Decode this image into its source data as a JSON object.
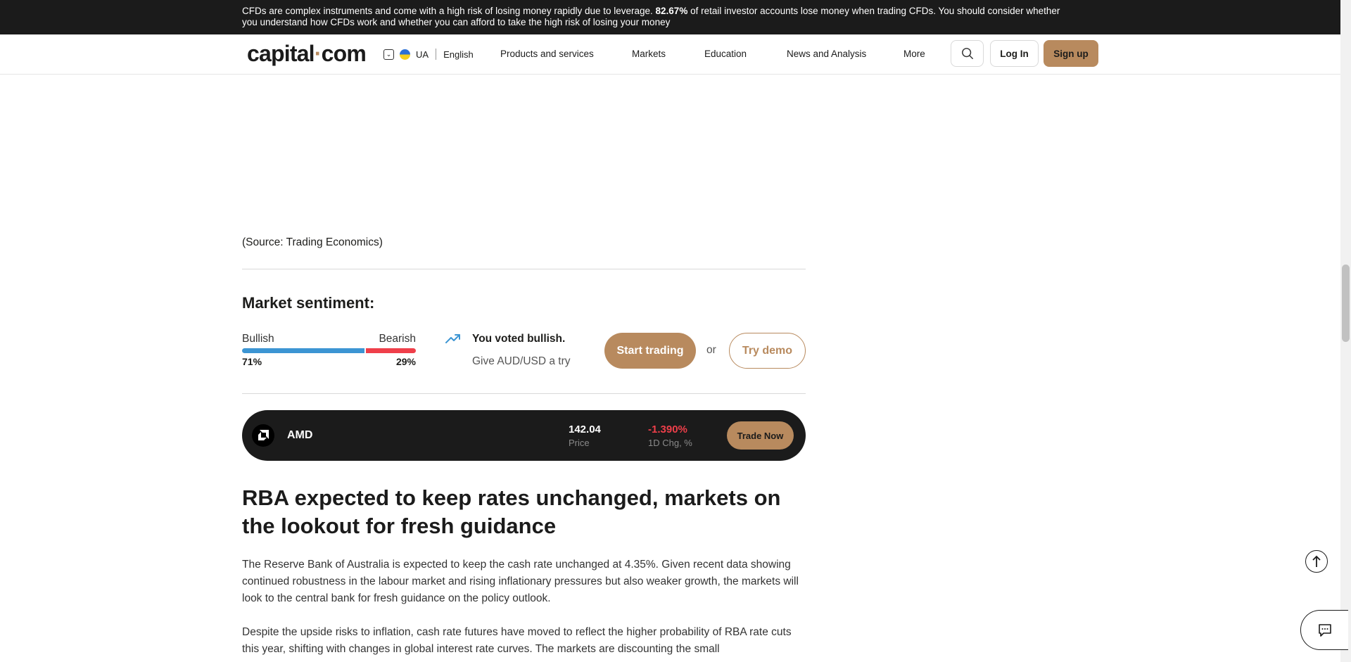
{
  "risk_banner": {
    "text_before": "CFDs are complex instruments and come with a high risk of losing money rapidly due to leverage. ",
    "percent": "82.67%",
    "text_after": " of retail investor accounts lose money when trading CFDs. You should consider whether you understand how CFDs work and whether you can afford to take the high risk of losing your money"
  },
  "header": {
    "logo_left": "capital",
    "logo_dot": "·",
    "logo_right": "com",
    "region_code": "UA",
    "language": "English",
    "nav": [
      "Products and services",
      "Markets",
      "Education",
      "News and Analysis",
      "More"
    ],
    "login_label": "Log In",
    "signup_label": "Sign up"
  },
  "article": {
    "source": "(Source: Trading Economics)",
    "headline": "RBA expected to keep rates unchanged, markets on the lookout for fresh guidance",
    "paragraphs": [
      "The Reserve Bank of Australia is expected to keep the cash rate unchanged at 4.35%. Given recent data showing continued robustness in the labour market and rising inflationary pressures but also weaker growth, the markets will look to the central bank for fresh guidance on the policy outlook.",
      "Despite the upside risks to inflation, cash rate futures have moved to reflect the higher probability of RBA rate cuts this year, shifting with changes in global interest rate curves. The markets are discounting the small"
    ]
  },
  "sentiment": {
    "title": "Market sentiment:",
    "bullish_label": "Bullish",
    "bearish_label": "Bearish",
    "bullish_pct": "71%",
    "bearish_pct": "29%",
    "bullish_fraction": 0.71,
    "voted_text": "You voted bullish.",
    "give_text": "Give AUD/USD a try",
    "start_label": "Start trading",
    "or_label": "or",
    "demo_label": "Try demo"
  },
  "ticker": {
    "name": "AMD",
    "price": "142.04",
    "price_label": "Price",
    "change": "-1.390%",
    "change_label": "1D Chg, %",
    "trade_label": "Trade Now"
  },
  "colors": {
    "accent": "#b88a5e",
    "bullish": "#3c95d3",
    "bearish": "#ef3f4a",
    "dark": "#1b1b1b"
  },
  "icons": [
    "chevron-down-icon",
    "flag-icon",
    "search-icon",
    "trend-up-icon",
    "amd-logo-icon",
    "arrow-up-icon",
    "chat-icon"
  ]
}
